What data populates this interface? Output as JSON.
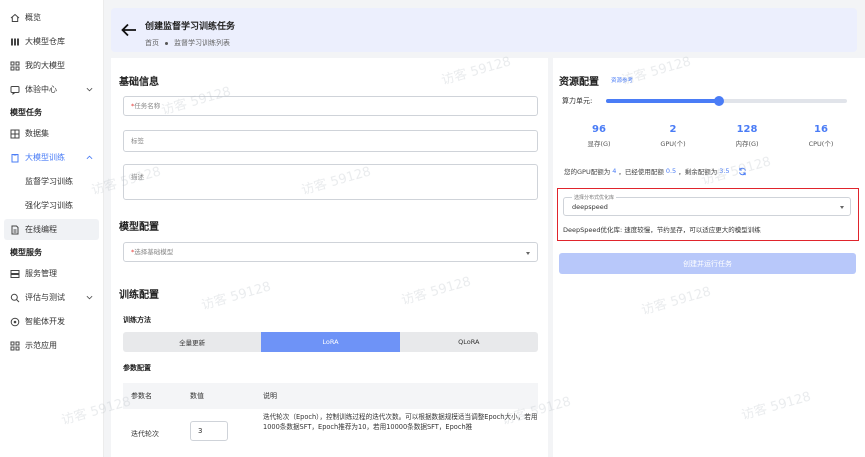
{
  "sidebar": {
    "items": [
      {
        "label": "概览",
        "icon": "home-icon"
      },
      {
        "label": "大模型仓库",
        "icon": "grid-icon"
      },
      {
        "label": "我的大模型",
        "icon": "apps-icon"
      },
      {
        "label": "体验中心",
        "icon": "chat-icon"
      }
    ],
    "group_model_task": "模型任务",
    "dataset": "数据集",
    "llm_training": "大模型训练",
    "supervised_training": "监督学习训练",
    "reinforcement_training": "强化学习训练",
    "online_coding": "在线编程",
    "group_model_service": "模型服务",
    "service_management": "服务管理",
    "eval_testing": "评估与测试",
    "agent_dev": "智能体开发",
    "sample_apps": "示范应用"
  },
  "header": {
    "title": "创建监督学习训练任务",
    "breadcrumb_home": "首页",
    "breadcrumb_current": "监督学习训练列表"
  },
  "basic_info": {
    "title": "基础信息",
    "task_name_placeholder": "任务名称",
    "tags_placeholder": "标签",
    "description_placeholder": "描述"
  },
  "model_config": {
    "title": "模型配置",
    "base_model_placeholder": "选择基础模型"
  },
  "training_config": {
    "title": "训练配置",
    "method_label": "训练方法",
    "methods": [
      "全量更新",
      "LoRA",
      "QLoRA"
    ],
    "selected_method": "LoRA",
    "params_label": "参数配置",
    "table_headers": [
      "参数名",
      "数值",
      "说明"
    ],
    "rows": [
      {
        "name": "迭代轮次",
        "value": "3",
        "description": "迭代轮次（Epoch），控制训练过程的迭代次数。可以根据数据规模适当调整Epoch大小，若用1000条数据SFT，Epoch推荐为10，若用10000条数据SFT，Epoch推"
      }
    ]
  },
  "resources": {
    "title": "资源配置",
    "ref_link": "资源参考",
    "compute_label": "算力单元:",
    "slider_fraction": 0.47,
    "stats": [
      {
        "value": "96",
        "label": "显存(G)"
      },
      {
        "value": "2",
        "label": "GPU(个)"
      },
      {
        "value": "128",
        "label": "内存(G)"
      },
      {
        "value": "16",
        "label": "CPU(个)"
      }
    ],
    "gpu_quota_prefix": "您的GPU配额为",
    "gpu_quota": "4",
    "used_prefix": "，已经使用配额",
    "used": "0.5",
    "remaining_prefix": "，剩余配额为",
    "remaining": "3.5",
    "optimizer_legend": "选择分布式优化库",
    "optimizer_value": "deepspeed",
    "optimizer_desc": "DeepSpeed优化库: 速度较慢，节约显存，可以适应更大的模型训练",
    "create_button": "创建并运行任务"
  },
  "watermark": "访客 59128",
  "colors": {
    "accent": "#4a7cf6",
    "header_bg": "#eceffd",
    "highlight_box": "#e0242c",
    "button_disabled": "#b8c8fa"
  }
}
